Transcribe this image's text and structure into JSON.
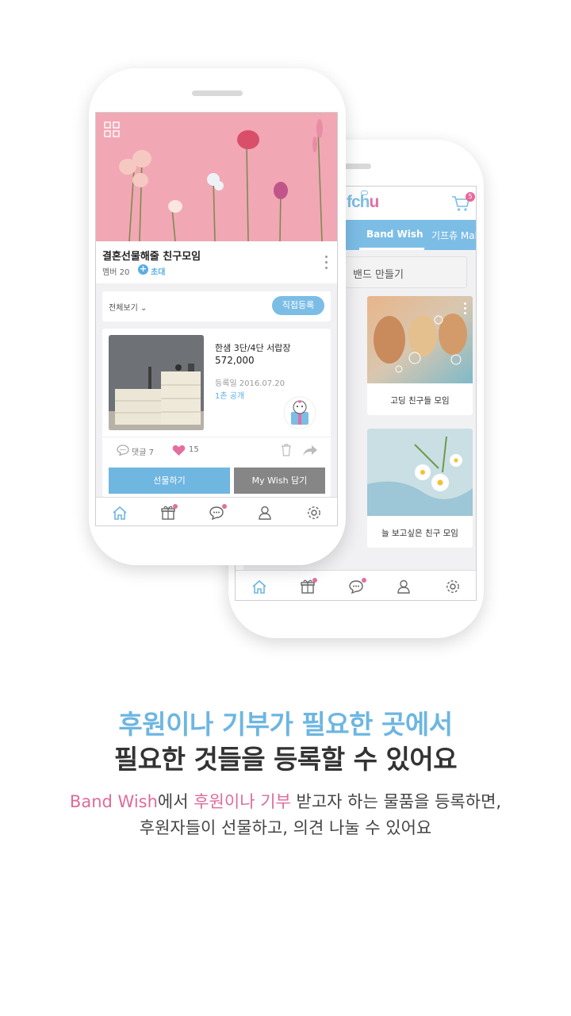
{
  "colors": {
    "accent_blue": "#7cbde6",
    "accent_pink": "#de6b9a",
    "headline_blue": "#6db6e1",
    "text_dark": "#333333"
  },
  "back_phone": {
    "logo": {
      "main": "fch",
      "tail": "u"
    },
    "cart": {
      "icon": "cart-icon",
      "badge": "5"
    },
    "tabs": {
      "partial": "a",
      "active": "Band Wish",
      "mall": "기프츄 Mal"
    },
    "band_make": "밴드 만들기",
    "cards": [
      {
        "title": "고딩 친구들 모임",
        "image": "bubbles-photo"
      },
      {
        "title": "늘 보고싶은 친구 모임",
        "image": "daisy-photo"
      }
    ],
    "nav": [
      "home-icon",
      "gift-icon",
      "chat-icon",
      "user-icon",
      "settings-icon"
    ]
  },
  "front_phone": {
    "hero_image": "pink-flowers-photo",
    "group": {
      "title": "결혼선물해줄 친구모임",
      "members": "멤버 20",
      "invite": "초대"
    },
    "filter": {
      "label": "전체보기",
      "register": "직접등록"
    },
    "item": {
      "name": "한샘 3단/4단 서랍장",
      "price": "572,000",
      "date": "등록일 2016.07.20",
      "visibility": "1촌 공개",
      "comments": "댓글 7",
      "likes": "15"
    },
    "buttons": {
      "gift": "선물하기",
      "wish": "My Wish 담기"
    },
    "nav": [
      "home-icon",
      "gift-icon",
      "chat-icon",
      "user-icon",
      "settings-icon"
    ]
  },
  "copy": {
    "headline1": "후원이나 기부가 필요한 곳에서",
    "headline2": "필요한 것들을 등록할 수 있어요",
    "desc_band_wish": "Band Wish",
    "desc_mid1": "에서 ",
    "desc_pink": "후원이나 기부",
    "desc_rest": " 받고자 하는 물품을 등록하면,",
    "desc2": "후원자들이 선물하고, 의견 나눌 수 있어요"
  }
}
